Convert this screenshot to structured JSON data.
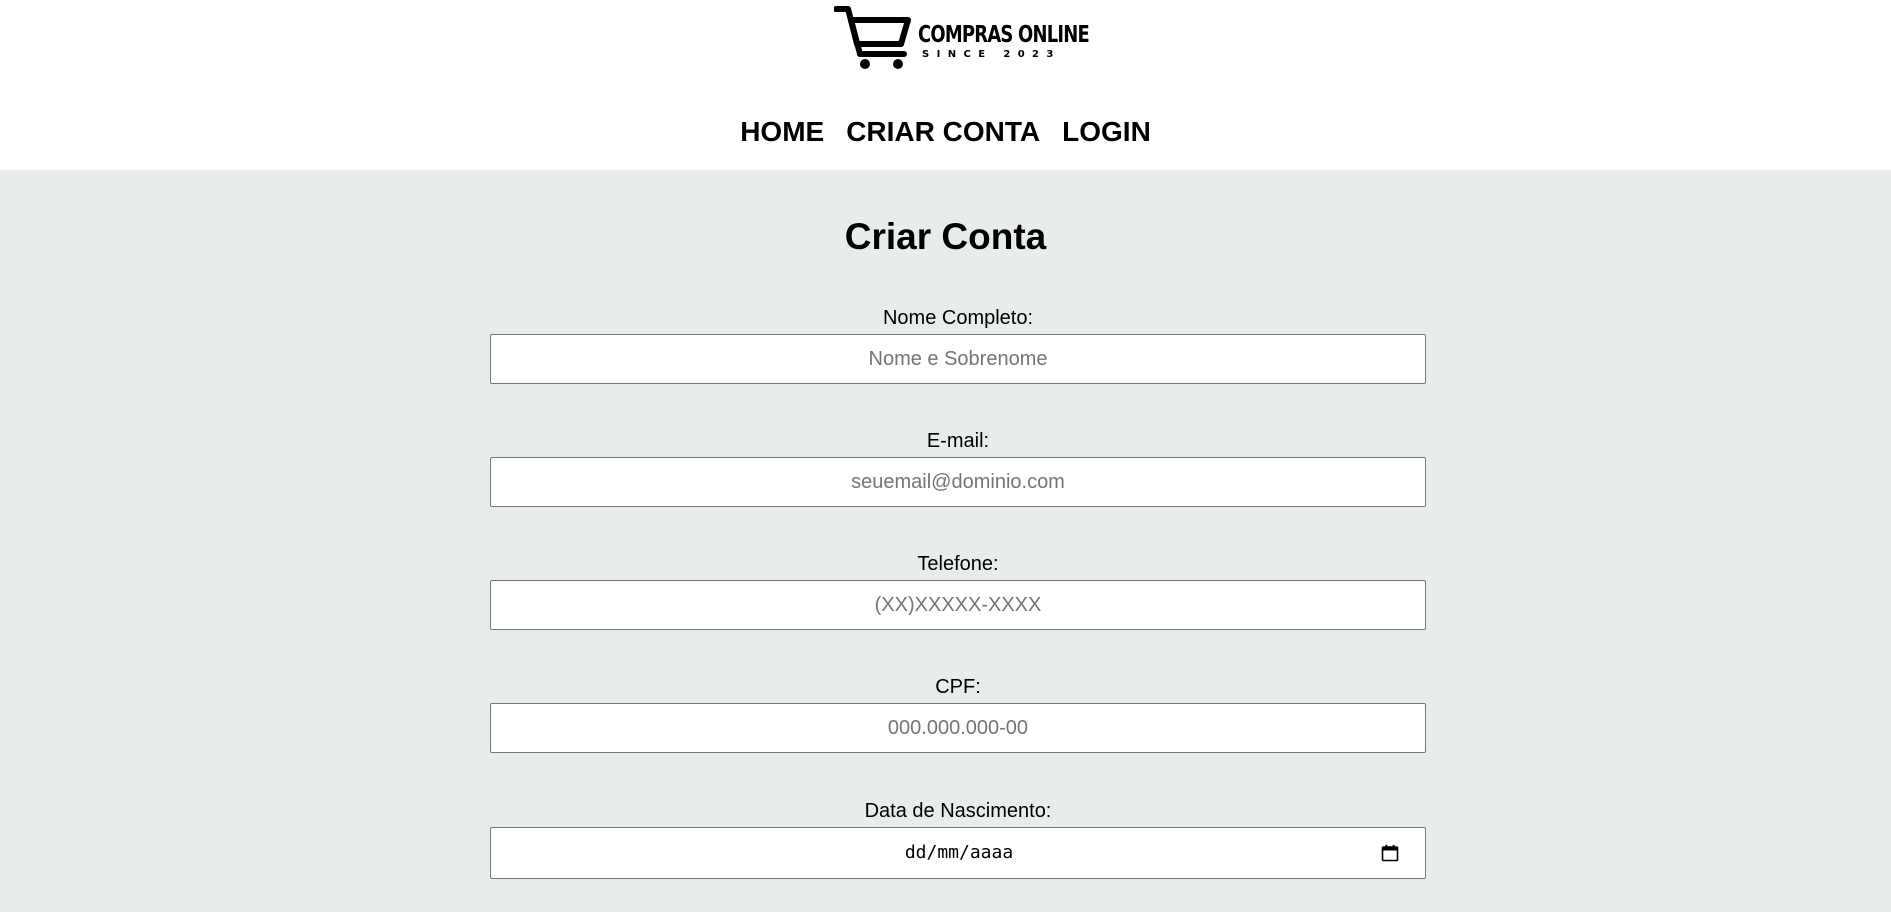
{
  "logo": {
    "title": "COMPRAS ONLINE",
    "subtitle": "SINCE 2023",
    "icon": "shopping-cart-icon"
  },
  "nav": {
    "items": [
      "HOME",
      "CRIAR CONTA",
      "LOGIN"
    ]
  },
  "page": {
    "title": "Criar Conta"
  },
  "form": {
    "fields": [
      {
        "label": "Nome Completo:",
        "placeholder": "Nome e Sobrenome",
        "value": ""
      },
      {
        "label": "E-mail:",
        "placeholder": "seuemail@dominio.com",
        "value": ""
      },
      {
        "label": "Telefone:",
        "placeholder": "(XX)XXXXX-XXXX",
        "value": ""
      },
      {
        "label": "CPF:",
        "placeholder": "000.000.000-00",
        "value": ""
      },
      {
        "label": "Data de Nascimento:",
        "placeholder": "dd/mm/aaaa",
        "value": "",
        "icon": "calendar-icon"
      }
    ]
  },
  "colors": {
    "background": "#e8ecec",
    "header": "#ffffff",
    "text": "#000000",
    "border": "#767676",
    "placeholder": "#757575"
  }
}
